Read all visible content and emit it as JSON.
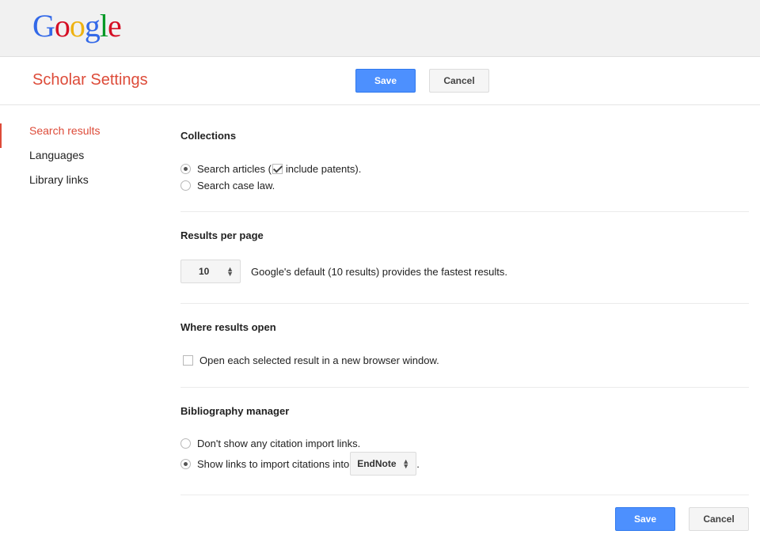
{
  "header": {
    "logo_letters": [
      {
        "ch": "G",
        "color": "#3369e8"
      },
      {
        "ch": "o",
        "color": "#d50f25"
      },
      {
        "ch": "o",
        "color": "#eeb211"
      },
      {
        "ch": "g",
        "color": "#3369e8"
      },
      {
        "ch": "l",
        "color": "#009925"
      },
      {
        "ch": "e",
        "color": "#d50f25"
      }
    ]
  },
  "subheader": {
    "title": "Scholar Settings",
    "save_label": "Save",
    "cancel_label": "Cancel"
  },
  "sidebar": {
    "items": [
      {
        "label": "Search results",
        "active": true
      },
      {
        "label": "Languages",
        "active": false
      },
      {
        "label": "Library links",
        "active": false
      }
    ]
  },
  "collections": {
    "title": "Collections",
    "option_articles_prefix": "Search articles (",
    "option_articles_suffix": "include patents).",
    "include_patents_checked": true,
    "option_caselaw": "Search case law.",
    "selected": "articles"
  },
  "results_per_page": {
    "title": "Results per page",
    "value": "10",
    "note": "Google's default (10 results) provides the fastest results."
  },
  "where_results_open": {
    "title": "Where results open",
    "option": "Open each selected result in a new browser window.",
    "checked": false
  },
  "bibliography": {
    "title": "Bibliography manager",
    "option_none": "Don't show any citation import links.",
    "option_import_prefix": "Show links to import citations into",
    "manager_value": "EndNote",
    "option_import_suffix": ".",
    "selected": "import"
  },
  "footer": {
    "save_label": "Save",
    "cancel_label": "Cancel"
  },
  "colors": {
    "accent_red": "#dd4b39",
    "primary_blue": "#4d90fe"
  }
}
